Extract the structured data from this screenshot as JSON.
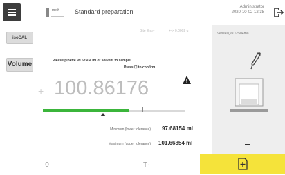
{
  "header": {
    "method_name": "Standard preparation",
    "method_icon_text": "meth",
    "user": "Administrator",
    "datetime": "2020-10-02   12:38",
    "menu_icon": "hamburger-menu-icon",
    "logout_icon": "logout-icon"
  },
  "controls": {
    "iso_cal": "isoCAL",
    "volume": "Volume"
  },
  "status_faint": {
    "left": "Bite Entry",
    "right": "+-> 0.0002 g"
  },
  "instruction": {
    "line1": "Please pipette 99.67504 ml of solvent to sample.",
    "line2": "Press ☐ to confirm."
  },
  "reading": {
    "sign": "+",
    "value": "100.86176"
  },
  "progress": {
    "fill_fraction": 0.6,
    "fill_color": "#3bb53b",
    "tick_fraction": 0.7
  },
  "tolerance": {
    "min_label": "Minimum (lower tolerance)",
    "min_value": "97.68154 ml",
    "max_label": "Maximum (upper tolerance)",
    "max_value": "101.66854 ml"
  },
  "right_panel": {
    "label": "Vessel (99.67504ml)"
  },
  "bottom": {
    "zero_label": "·0·",
    "tare_label": "·T·",
    "confirm_icon": "confirm-document-icon",
    "accent": "#f5e33a"
  }
}
